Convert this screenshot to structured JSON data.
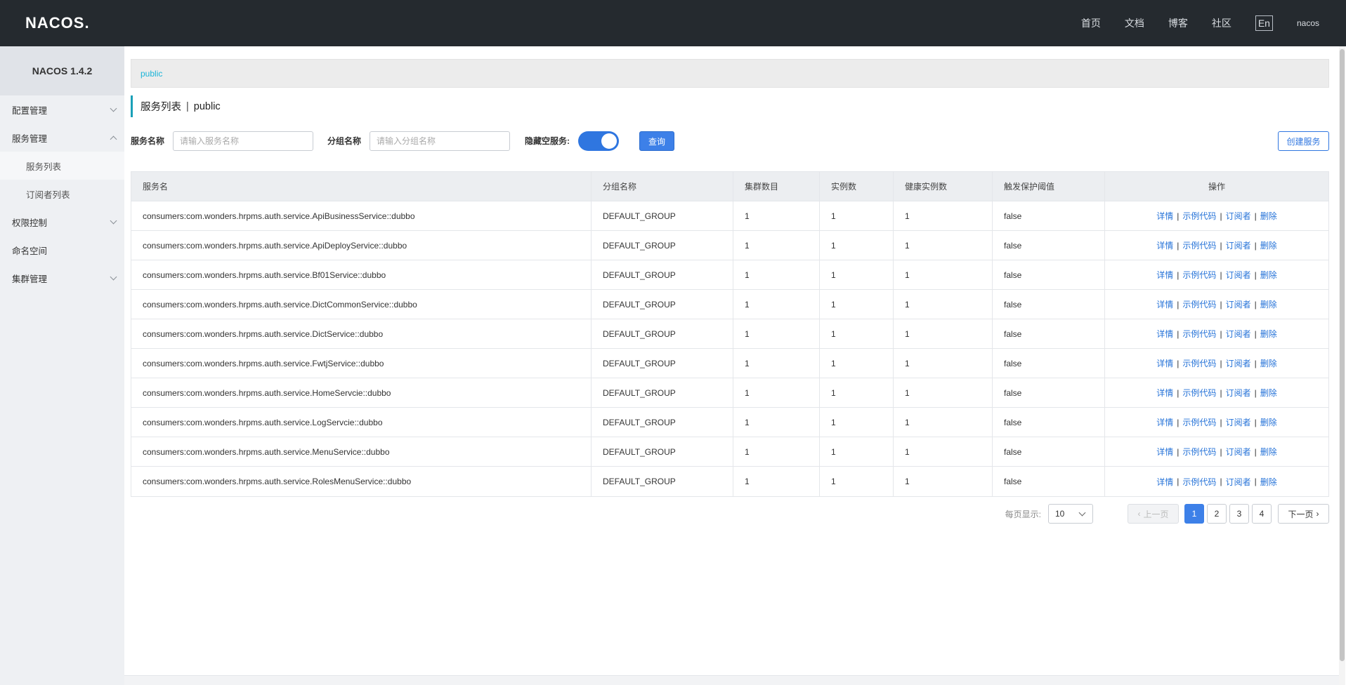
{
  "header": {
    "logo_text": "NACOS.",
    "nav": [
      "首页",
      "文档",
      "博客",
      "社区"
    ],
    "lang_label": "En",
    "user": "nacos"
  },
  "sidebar": {
    "version": "NACOS 1.4.2",
    "items": [
      {
        "label": "配置管理",
        "expanded": false
      },
      {
        "label": "服务管理",
        "expanded": true,
        "children": [
          {
            "label": "服务列表",
            "active": true
          },
          {
            "label": "订阅者列表",
            "active": false
          }
        ]
      },
      {
        "label": "权限控制",
        "expanded": false
      },
      {
        "label": "命名空间"
      },
      {
        "label": "集群管理",
        "expanded": false
      }
    ]
  },
  "main": {
    "breadcrumb": "public",
    "title": "服务列表",
    "title_sep": "|",
    "namespace": "public",
    "filter": {
      "service_label": "服务名称",
      "service_placeholder": "请输入服务名称",
      "group_label": "分组名称",
      "group_placeholder": "请输入分组名称",
      "hide_empty_label": "隐藏空服务:",
      "hide_empty_on": true,
      "query_button": "查询",
      "create_button": "创建服务"
    },
    "table": {
      "columns": [
        "服务名",
        "分组名称",
        "集群数目",
        "实例数",
        "健康实例数",
        "触发保护阈值",
        "操作"
      ],
      "ops": [
        "详情",
        "示例代码",
        "订阅者",
        "删除"
      ],
      "rows": [
        [
          "consumers:com.wonders.hrpms.auth.service.ApiBusinessService::dubbo",
          "DEFAULT_GROUP",
          "1",
          "1",
          "1",
          "false"
        ],
        [
          "consumers:com.wonders.hrpms.auth.service.ApiDeployService::dubbo",
          "DEFAULT_GROUP",
          "1",
          "1",
          "1",
          "false"
        ],
        [
          "consumers:com.wonders.hrpms.auth.service.Bf01Service::dubbo",
          "DEFAULT_GROUP",
          "1",
          "1",
          "1",
          "false"
        ],
        [
          "consumers:com.wonders.hrpms.auth.service.DictCommonService::dubbo",
          "DEFAULT_GROUP",
          "1",
          "1",
          "1",
          "false"
        ],
        [
          "consumers:com.wonders.hrpms.auth.service.DictService::dubbo",
          "DEFAULT_GROUP",
          "1",
          "1",
          "1",
          "false"
        ],
        [
          "consumers:com.wonders.hrpms.auth.service.FwtjService::dubbo",
          "DEFAULT_GROUP",
          "1",
          "1",
          "1",
          "false"
        ],
        [
          "consumers:com.wonders.hrpms.auth.service.HomeServcie::dubbo",
          "DEFAULT_GROUP",
          "1",
          "1",
          "1",
          "false"
        ],
        [
          "consumers:com.wonders.hrpms.auth.service.LogServcie::dubbo",
          "DEFAULT_GROUP",
          "1",
          "1",
          "1",
          "false"
        ],
        [
          "consumers:com.wonders.hrpms.auth.service.MenuService::dubbo",
          "DEFAULT_GROUP",
          "1",
          "1",
          "1",
          "false"
        ],
        [
          "consumers:com.wonders.hrpms.auth.service.RolesMenuService::dubbo",
          "DEFAULT_GROUP",
          "1",
          "1",
          "1",
          "false"
        ]
      ]
    },
    "pagination": {
      "per_page_label": "每页显示:",
      "per_page": "10",
      "prev": "上一页",
      "next": "下一页",
      "pages": [
        "1",
        "2",
        "3",
        "4"
      ],
      "current": "1"
    }
  },
  "colors": {
    "header_bg": "#252a2f",
    "primary": "#3d80e8",
    "link": "#2673d8",
    "breadcrumb": "#1ab4d8",
    "title_accent": "#1aa0b8"
  }
}
